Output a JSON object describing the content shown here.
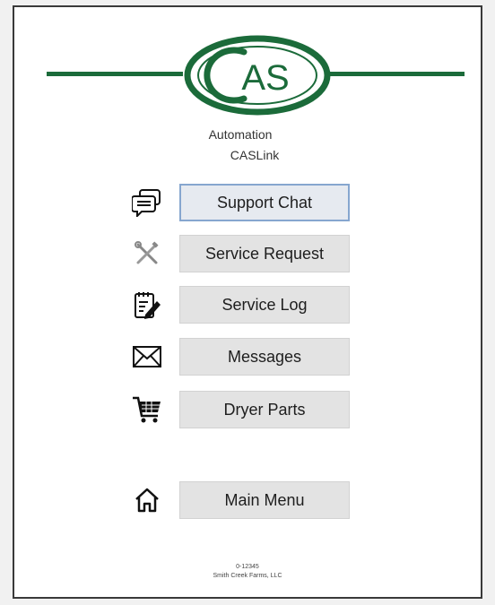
{
  "brand": {
    "logo_text": "AS",
    "app_line1": "Automation",
    "app_line2": "CASLink",
    "accent_color": "#1b6b3a"
  },
  "menu": {
    "items": [
      {
        "label": "Support Chat",
        "icon": "chat-bubbles-icon"
      },
      {
        "label": "Service Request",
        "icon": "wrench-screwdriver-icon"
      },
      {
        "label": "Service Log",
        "icon": "notepad-pencil-icon"
      },
      {
        "label": "Messages",
        "icon": "envelope-icon"
      },
      {
        "label": "Dryer Parts",
        "icon": "shopping-cart-icon"
      },
      {
        "label": "Main Menu",
        "icon": "home-icon"
      }
    ]
  },
  "footer": {
    "line1": "0-12345",
    "line2": "Smith Creek Farms, LLC"
  }
}
